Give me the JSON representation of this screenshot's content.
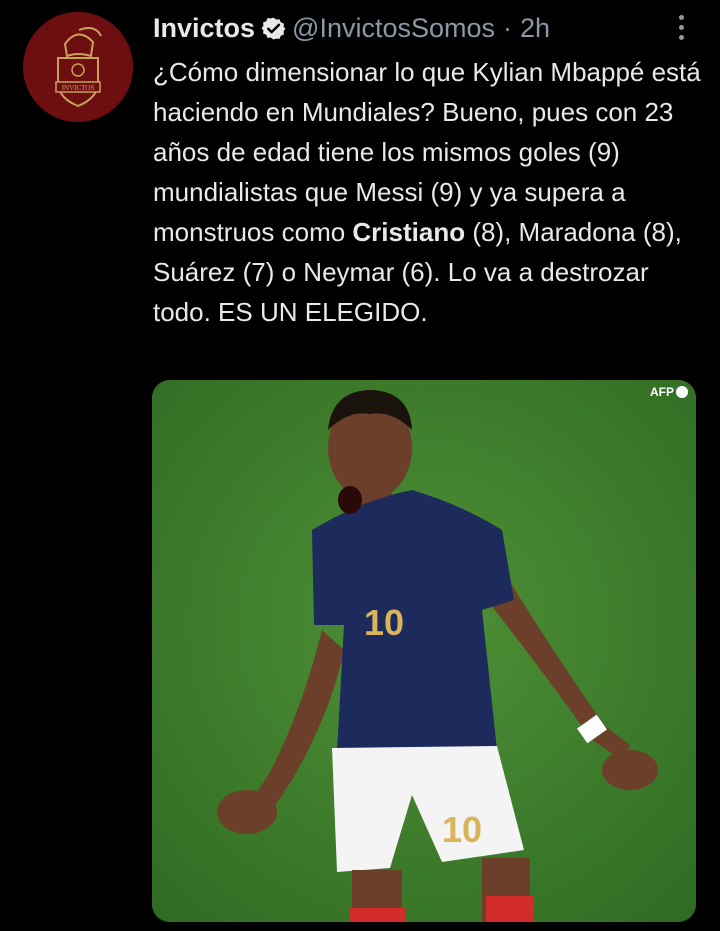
{
  "tweet": {
    "author_name": "Invictos",
    "handle": "@InvictosSomos",
    "separator": "·",
    "time": "2h",
    "verified_icon": "verified-badge-icon",
    "more_icon": "more-options-icon",
    "avatar_logo_text": "INVICTOS",
    "text_before_bold": "¿Cómo dimensionar lo que Kylian Mbappé está haciendo en Mundiales? Bueno, pues con 23 años de edad tiene los mismos goles (9) mundialistas que Messi (9) y ya supera a monstruos como ",
    "text_bold": "Cristiano",
    "text_after_bold": " (8), Maradona (8), Suárez (7) o Neymar (6). Lo va a destrozar todo. ES UN ELEGIDO.",
    "media_credit": "AFP",
    "jersey_number": "10",
    "shorts_number": "10"
  },
  "colors": {
    "background": "#000000",
    "text": "#e7e9ea",
    "secondary_text": "#8b98a5",
    "avatar_bg": "#6d0f10",
    "pitch_green": "#3f7d2c",
    "jersey_blue": "#1c2a5c"
  }
}
